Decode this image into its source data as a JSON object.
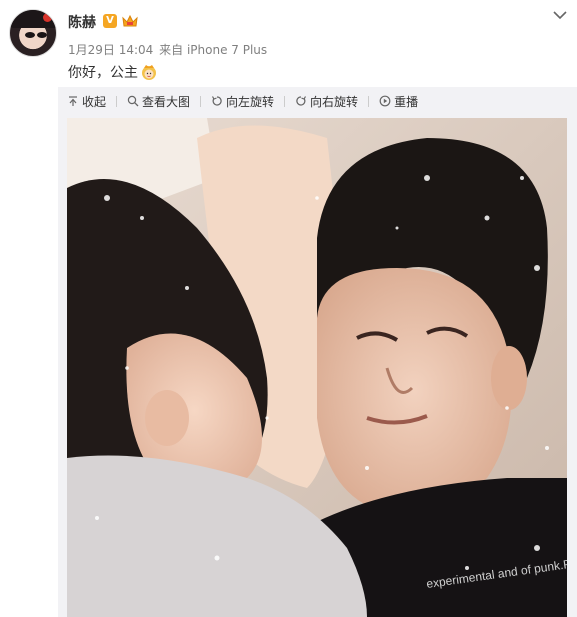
{
  "post": {
    "author_name": "陈赫",
    "badge_label": "V",
    "timestamp": "1月29日 14:04",
    "source": "来自 iPhone 7 Plus",
    "text": "你好，公主",
    "emoji": "princess-emoji"
  },
  "toolbar": {
    "collapse": "收起",
    "view_large": "查看大图",
    "rotate_left": "向左旋转",
    "rotate_right": "向右旋转",
    "replay": "重播"
  },
  "photo": {
    "shirt_text": "experimental and of punk.Pose-"
  },
  "colors": {
    "badge": "#f5a623",
    "panel_bg": "#f2f2f5",
    "meta_text": "#808080"
  }
}
